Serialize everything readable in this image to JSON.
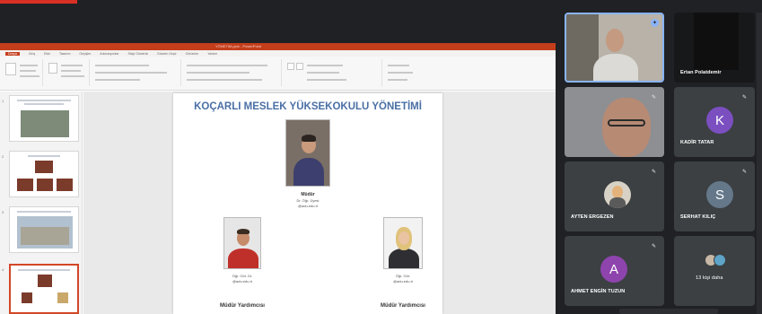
{
  "colors": {
    "page_bg": "#1f2124",
    "tile_bg": "#3c4043",
    "ppt_accent": "#c43e1c",
    "title_blue": "#4a6fa5",
    "avatar_k": "#7b4fc0",
    "avatar_s": "#64788a",
    "avatar_a": "#8e44ad",
    "self_border": "#8ab4f8"
  },
  "presentation": {
    "window_title": "YÖNETİM.pptx - PowerPoint",
    "menu": [
      "Dosya",
      "Giriş",
      "Ekle",
      "Tasarım",
      "Geçişler",
      "Animasyonlar",
      "Slayt Gösterisi",
      "Gözden Geçir",
      "Görünüm",
      "Yardım"
    ],
    "slide": {
      "title": "KOÇARLI MESLEK YÜKSEKOKULU YÖNETİMİ",
      "director": {
        "role": "Müdür",
        "name": "Dr. Öğr. Üyesi",
        "email": "@adu.edu.tr"
      },
      "assistant_left": {
        "name": "Öğr. Gör. Dr.",
        "email": "@adu.edu.tr",
        "role": "Müdür Yardımcısı"
      },
      "assistant_right": {
        "name": "Öğr. Gör.",
        "email": "@adu.edu.tr",
        "role": "Müdür Yardımcısı"
      }
    },
    "thumbnails": [
      {
        "num": "1"
      },
      {
        "num": "2"
      },
      {
        "num": "3"
      },
      {
        "num": "4"
      }
    ]
  },
  "participants": {
    "self": {
      "name": ""
    },
    "p1": {
      "name": "Ertan Polatdemir"
    },
    "p2": {
      "name": ""
    },
    "p3": {
      "name": "KADİR TATAR",
      "initial": "K"
    },
    "p4": {
      "name": "AYTEN ERGEZEN"
    },
    "p5": {
      "name": "SERHAT KILIÇ",
      "initial": "S"
    },
    "p6": {
      "name": "AHMET ENGİN TUZUN",
      "initial": "A"
    },
    "more": {
      "label": "13 kişi daha"
    }
  },
  "icons": {
    "mic": "mic-off-icon",
    "pin": "pin-icon"
  }
}
